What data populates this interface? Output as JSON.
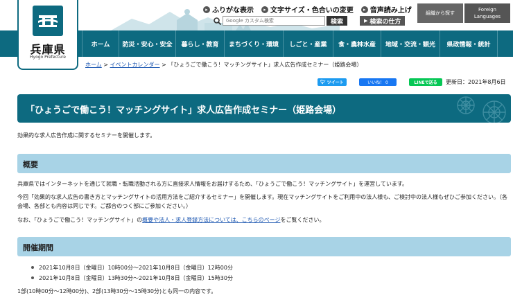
{
  "header": {
    "logo_name": "兵庫県",
    "logo_sub": "Hyogo Prefecture",
    "util_links": [
      {
        "label": "ふりがな表示",
        "icon": "furigana-icon"
      },
      {
        "label": "文字サイズ・色合いの変更",
        "icon": "text-size-icon"
      },
      {
        "label": "音声読み上げ",
        "icon": "speaker-icon"
      }
    ],
    "search_placeholder": "Google カスタム検索",
    "search_button": "検索",
    "search_howto": "検索の仕方",
    "org_button": "組織から探す",
    "lang_button": "Foreign Languages"
  },
  "nav": {
    "items": [
      "ホーム",
      "防災・安心・安全",
      "暮らし・教育",
      "まちづくり・環境",
      "しごと・産業",
      "食・農林水産",
      "地域・交流・観光",
      "県政情報・統計"
    ]
  },
  "breadcrumb": {
    "home": "ホーム",
    "sep1": " > ",
    "events": "イベントカレンダー",
    "sep2": " > ",
    "current": "「ひょうごで働こう！マッチングサイト」求人広告作成セミナー（姫路会場）"
  },
  "social": {
    "tweet": "ツイート",
    "like": "いいね！ 0",
    "line": "LINEで送る",
    "updated": "更新日：2021年8月6日"
  },
  "page_title": "「ひょうごで働こう！マッチングサイト」求人広告作成セミナー（姫路会場）",
  "intro": "効果的な求人広告作成に関するセミナーを開催します。",
  "overview": {
    "heading": "概要",
    "p1": "兵庫県ではインターネットを通じて就職・転職活動される方に直接求人情報をお届けするため、「ひょうごで働こう！マッチングサイト」を運営しています。",
    "p2": "今回「効果的な求人広告の書き方とマッチングサイトの活用方法をご紹介するセミナー」を開催します。現在マッチングサイトをご利用中の法人様も、ご検討中の法人様もぜひご参加ください。（各会場、各部とも内容は同じです。ご都合のつく部にご参加ください。）",
    "p3_pre": "なお、「ひょうごで働こう！マッチングサイト」の",
    "p3_link": "概要や法人・求人登録方法については、こちらのページ",
    "p3_post": "をご覧ください。"
  },
  "period": {
    "heading": "開催期間",
    "items": [
      "2021年10月8日（金曜日）10時00分～2021年10月8日（金曜日）12時00分",
      "2021年10月8日（金曜日）13時30分～2021年10月8日（金曜日）15時30分"
    ],
    "note": "1部(10時00分～12時00分)、2部(13時30分～15時30分)とも同一の内容です。"
  },
  "colors": {
    "brand_teal": "#0d6a80",
    "section_blue": "#a8d3e6",
    "link": "#1a55b0"
  }
}
